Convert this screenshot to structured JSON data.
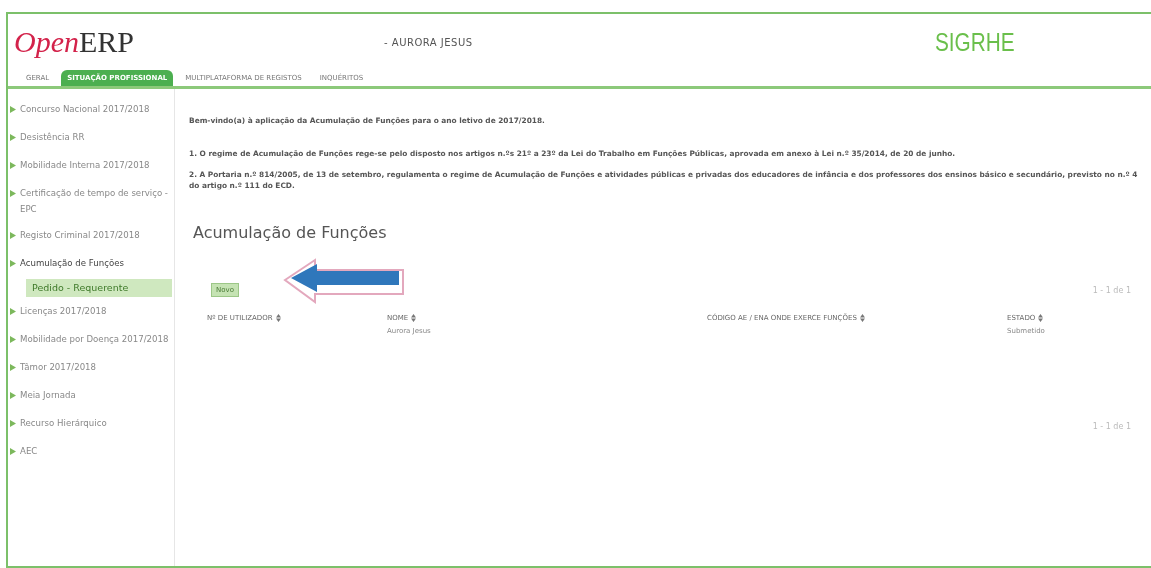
{
  "header": {
    "logo": {
      "part_1": "Open",
      "part_2": "ERP"
    },
    "user": "- AURORA JESUS",
    "brand": "SIGRHE"
  },
  "tabs": [
    {
      "label": "GERAL",
      "selected": false
    },
    {
      "label": "SITUAÇÃO PROFISSIONAL",
      "selected": true
    },
    {
      "label": "MULTIPLATAFORMA DE REGISTOS",
      "selected": false
    },
    {
      "label": "INQUÉRITOS",
      "selected": false
    }
  ],
  "sidebar": {
    "items": [
      {
        "label": "Concurso Nacional 2017/2018",
        "expanded": false
      },
      {
        "label": "Desistência RR",
        "expanded": false
      },
      {
        "label": "Mobilidade Interna 2017/2018",
        "expanded": false
      },
      {
        "label": "Certificação de tempo de serviço - EPC",
        "expanded": false
      },
      {
        "label": "Registo Criminal 2017/2018",
        "expanded": false
      },
      {
        "label": "Acumulação de Funções",
        "expanded": true,
        "children": [
          {
            "label": "Pedido - Requerente",
            "selected": true
          }
        ]
      },
      {
        "label": "Licenças 2017/2018",
        "expanded": false
      },
      {
        "label": "Mobilidade por Doença 2017/2018",
        "expanded": false
      },
      {
        "label": "Tâmor 2017/2018",
        "expanded": false
      },
      {
        "label": "Meia Jornada",
        "expanded": false
      },
      {
        "label": "Recurso Hierárquico",
        "expanded": false
      },
      {
        "label": "AEC",
        "expanded": false
      }
    ]
  },
  "content": {
    "intro": [
      "Bem-vindo(a) à aplicação da Acumulação de Funções para o ano letivo de 2017/2018.",
      "1. O regime de Acumulação de Funções rege-se pelo disposto nos artigos n.ºs 21º a 23º da Lei do Trabalho em Funções Públicas, aprovada em anexo à Lei n.º 35/2014, de 20 de junho.",
      "2. A Portaria n.º 814/2005, de 13 de setembro, regulamenta o regime de Acumulação de Funções e atividades públicas e privadas dos educadores de infância e dos professores dos ensinos básico e secundário, previsto no n.º 4 do artigo n.º 111 do ECD."
    ],
    "title": "Acumulação de Funções",
    "new_button": "Novo",
    "pager_top": "1 - 1 de 1",
    "pager_bottom": "1 - 1 de 1",
    "table": {
      "columns": [
        "Nº DE UTILIZADOR",
        "NOME",
        "CÓDIGO AE / ENA ONDE EXERCE FUNÇÕES",
        "ESTADO"
      ],
      "rows": [
        [
          "",
          "Aurora Jesus",
          "",
          "Submetido"
        ]
      ]
    }
  }
}
